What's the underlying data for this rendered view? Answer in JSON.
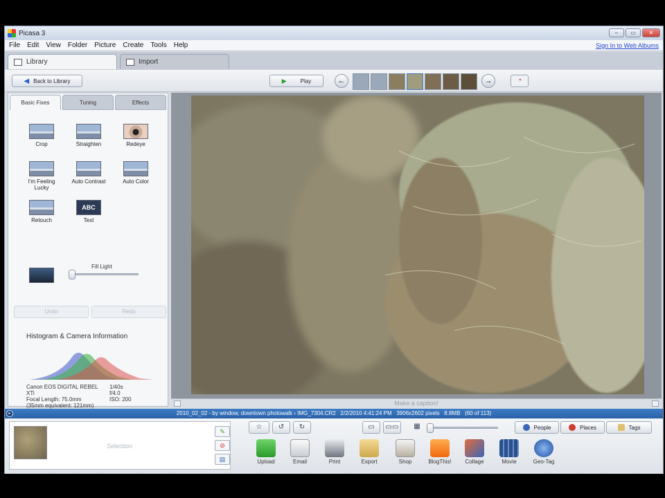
{
  "window": {
    "title": "Picasa 3",
    "controls": [
      "minimize",
      "maximize",
      "close"
    ]
  },
  "menu": {
    "items": [
      "File",
      "Edit",
      "View",
      "Folder",
      "Picture",
      "Create",
      "Tools",
      "Help"
    ],
    "sign_in": "Sign In to Web Albums"
  },
  "tabs": [
    {
      "label": "Library"
    },
    {
      "label": "Import"
    }
  ],
  "toolbar": {
    "back_label": "Back to Library",
    "play_label": "Play"
  },
  "edit_panel": {
    "tabs": [
      "Basic Fixes",
      "Tuning",
      "Effects"
    ],
    "tools": [
      {
        "label": "Crop",
        "icon": "crop-icon"
      },
      {
        "label": "Straighten",
        "icon": "straighten-icon"
      },
      {
        "label": "Redeye",
        "icon": "redeye-icon"
      },
      {
        "label": "I'm Feeling Lucky",
        "icon": "lucky-icon"
      },
      {
        "label": "Auto Contrast",
        "icon": "contrast-icon"
      },
      {
        "label": "Auto Color",
        "icon": "color-icon"
      },
      {
        "label": "Retouch",
        "icon": "retouch-icon"
      },
      {
        "label": "Text",
        "icon": "text-icon"
      }
    ],
    "text_icon_label": "ABC",
    "fill_light_label": "Fill Light",
    "fill_light_value": 0,
    "undo_label": "Undo",
    "redo_label": "Redo",
    "histogram_title": "Histogram & Camera Information",
    "camera": {
      "model": "Canon EOS DIGITAL REBEL XTi",
      "shutter": "1/40s",
      "aperture": "f/4.0",
      "focal": "Focal Length: 75.0mm",
      "focal_equiv": "(35mm equivalent: 121mm)",
      "iso": "ISO: 200"
    }
  },
  "caption_placeholder": "Make a caption!",
  "status": {
    "path": "2010_02_02 - by window, downtown photowalk › IMG_7304.CR2",
    "datetime": "2/2/2010 4:41:24 PM",
    "dimensions": "3906x2602 pixels",
    "size": "8.8MB",
    "index": "(60 of 113)"
  },
  "tray": {
    "label": "Selection"
  },
  "filters": {
    "people": "People",
    "places": "Places",
    "tags": "Tags"
  },
  "actions": [
    "Upload",
    "Email",
    "Print",
    "Export",
    "Shop",
    "BlogThis!",
    "Collage",
    "Movie",
    "Geo-Tag"
  ],
  "colors": {
    "status_bar": "#2a62a8",
    "accent": "#2a63c6"
  }
}
